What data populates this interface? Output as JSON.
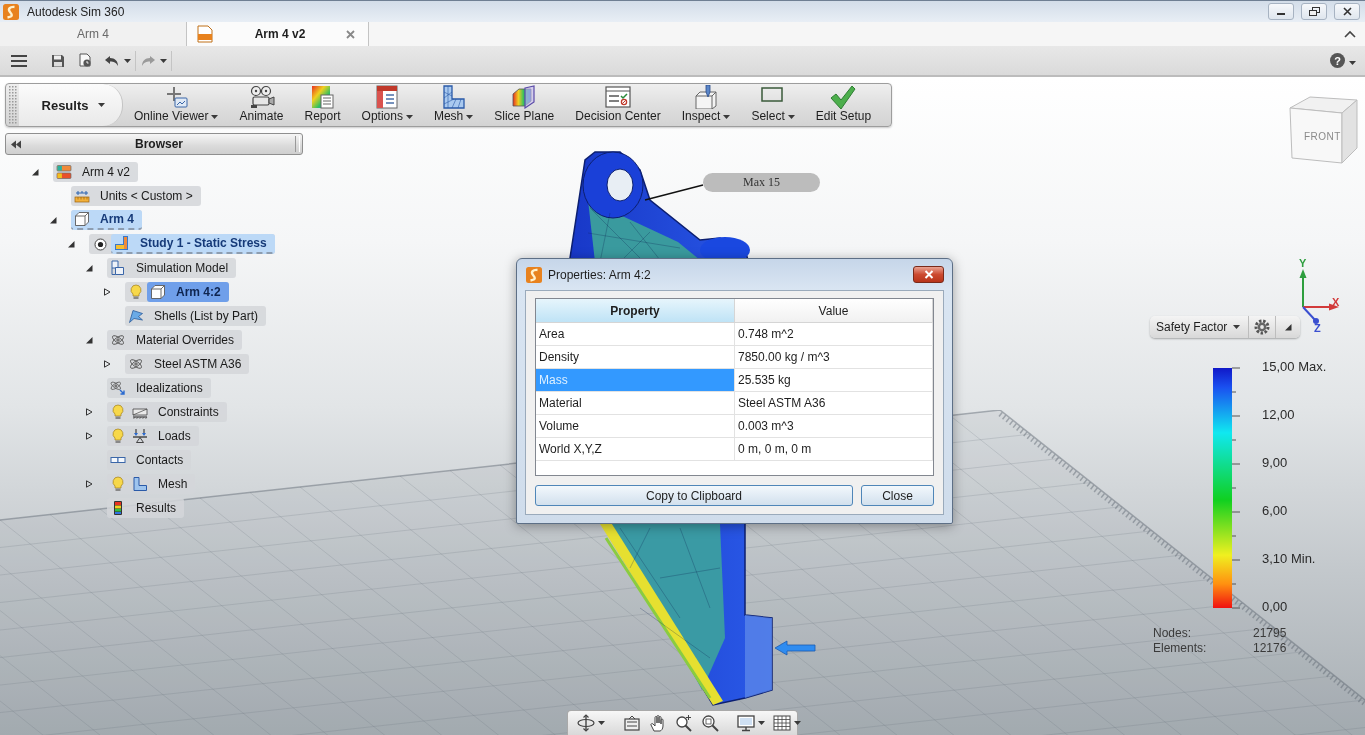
{
  "window": {
    "title": "Autodesk Sim 360"
  },
  "document_tabs": [
    {
      "label": "Arm 4",
      "selected": false
    },
    {
      "label": "Arm 4 v2",
      "selected": true
    }
  ],
  "quick_access": {
    "help": "?"
  },
  "ribbon": {
    "workspace": "Results",
    "tools": [
      {
        "label": "Online Viewer",
        "dropdown": true
      },
      {
        "label": "Animate",
        "dropdown": false
      },
      {
        "label": "Report",
        "dropdown": false
      },
      {
        "label": "Options",
        "dropdown": true
      },
      {
        "label": "Mesh",
        "dropdown": true
      },
      {
        "label": "Slice Plane",
        "dropdown": false
      },
      {
        "label": "Decision Center",
        "dropdown": false
      },
      {
        "label": "Inspect",
        "dropdown": true
      },
      {
        "label": "Select",
        "dropdown": true
      },
      {
        "label": "Edit Setup",
        "dropdown": false
      }
    ]
  },
  "browser": {
    "title": "Browser",
    "tree": [
      {
        "label": "Arm 4 v2",
        "kind": "design",
        "expanded": true,
        "active": false,
        "selected": false,
        "children": [
          {
            "label": "Units < Custom >",
            "kind": "units",
            "active": false,
            "selected": false
          },
          {
            "label": "Arm 4",
            "kind": "component",
            "expanded": true,
            "active": true,
            "selected": false,
            "children": [
              {
                "label": "Study 1 - Static Stress",
                "kind": "study",
                "expanded": true,
                "active": true,
                "selected": false,
                "children": [
                  {
                    "label": "Simulation Model",
                    "kind": "model",
                    "expanded": true,
                    "active": false,
                    "selected": false,
                    "children": [
                      {
                        "label": "Arm 4:2",
                        "kind": "body",
                        "expanded": false,
                        "visible": true,
                        "active": false,
                        "selected": true
                      },
                      {
                        "label": "Shells (List by Part)",
                        "kind": "shells",
                        "active": false,
                        "selected": false
                      }
                    ]
                  },
                  {
                    "label": "Material Overrides",
                    "kind": "materials",
                    "expanded": true,
                    "active": false,
                    "selected": false,
                    "children": [
                      {
                        "label": "Steel ASTM A36",
                        "kind": "material",
                        "expanded": false,
                        "active": false,
                        "selected": false
                      }
                    ]
                  },
                  {
                    "label": "Idealizations",
                    "kind": "idealizations",
                    "active": false,
                    "selected": false
                  },
                  {
                    "label": "Constraints",
                    "kind": "constraints",
                    "expanded": false,
                    "visible": true,
                    "active": false,
                    "selected": false
                  },
                  {
                    "label": "Loads",
                    "kind": "loads",
                    "expanded": false,
                    "visible": true,
                    "active": false,
                    "selected": false
                  },
                  {
                    "label": "Contacts",
                    "kind": "contacts",
                    "active": false,
                    "selected": false
                  },
                  {
                    "label": "Mesh",
                    "kind": "mesh",
                    "expanded": false,
                    "visible": true,
                    "active": false,
                    "selected": false
                  },
                  {
                    "label": "Results",
                    "kind": "results",
                    "active": false,
                    "selected": false
                  }
                ]
              }
            ]
          }
        ]
      }
    ]
  },
  "annotation": {
    "text": "Max 15"
  },
  "view_cube": {
    "face": "FRONT"
  },
  "axes": [
    {
      "label": "Y",
      "color": "#2e9e3e"
    },
    {
      "label": "X",
      "color": "#d23a3a"
    },
    {
      "label": "Z",
      "color": "#3a4fd0"
    }
  ],
  "result_bar": {
    "result": "Safety Factor"
  },
  "legend": {
    "labels": [
      "15,00 Max.",
      "12,00",
      "9,00",
      "6,00",
      "3,10 Min.",
      "0,00"
    ]
  },
  "stats": [
    {
      "label": "Nodes:",
      "value": "21795"
    },
    {
      "label": "Elements:",
      "value": "12176"
    }
  ],
  "dialog": {
    "title": "Properties: Arm 4:2",
    "columns": [
      {
        "label": "Property",
        "selected": true
      },
      {
        "label": "Value",
        "selected": false
      }
    ],
    "rows": [
      {
        "property": "Area",
        "value": "0.748 m^2",
        "selected": false
      },
      {
        "property": "Density",
        "value": "7850.00 kg / m^3",
        "selected": false
      },
      {
        "property": "Mass",
        "value": "25.535 kg",
        "selected": true
      },
      {
        "property": "Material",
        "value": "Steel ASTM A36",
        "selected": false
      },
      {
        "property": "Volume",
        "value": "0.003 m^3",
        "selected": false
      },
      {
        "property": "World X,Y,Z",
        "value": "0 m, 0 m, 0 m",
        "selected": false
      }
    ],
    "buttons": [
      "Copy to Clipboard",
      "Close"
    ]
  }
}
